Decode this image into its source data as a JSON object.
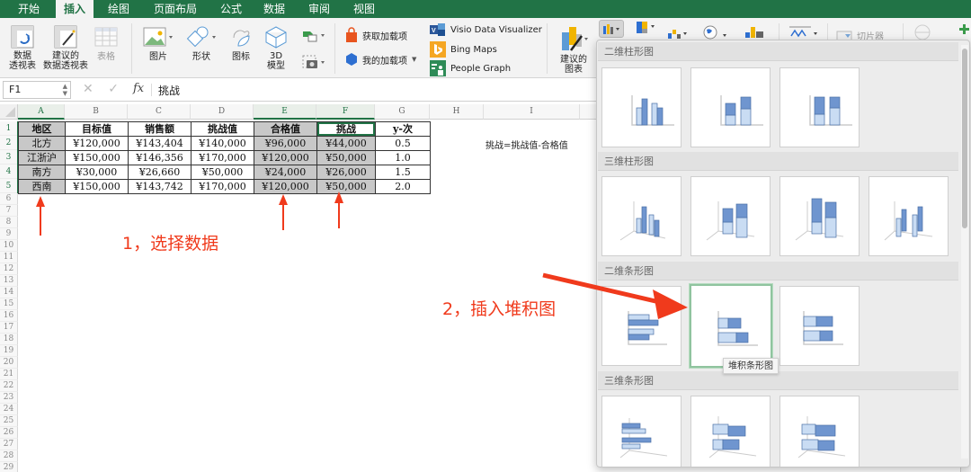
{
  "tabs": [
    {
      "label": "开始",
      "active": false
    },
    {
      "label": "插入",
      "active": true
    },
    {
      "label": "绘图",
      "active": false
    },
    {
      "label": "页面布局",
      "active": false
    },
    {
      "label": "公式",
      "active": false
    },
    {
      "label": "数据",
      "active": false
    },
    {
      "label": "审阅",
      "active": false
    },
    {
      "label": "视图",
      "active": false
    }
  ],
  "ribbon": {
    "pivot_table": "数据\n透视表",
    "pivot_table_l1": "数据",
    "pivot_table_l2": "透视表",
    "recommended_pivot_l1": "建议的",
    "recommended_pivot_l2": "数据透视表",
    "table": "表格",
    "pictures": "图片",
    "shapes": "形状",
    "icons": "图标",
    "model_3d_l1": "3D",
    "model_3d_l2": "模型",
    "get_addins": "获取加载项",
    "my_addins": "我的加载项",
    "visio": "Visio Data Visualizer",
    "bing_maps": "Bing Maps",
    "people_graph": "People Graph",
    "recommended_charts_l1": "建议的",
    "recommended_charts_l2": "图表",
    "slicer": "切片器",
    "colors": {
      "accent": "#217346",
      "office_orange": "#e8541e",
      "bing": "#f5a623",
      "visio": "#2b579a"
    }
  },
  "formula_bar": {
    "name_box": "F1",
    "fx": "fx",
    "value": "挑战"
  },
  "sheet": {
    "columns": [
      "A",
      "B",
      "C",
      "D",
      "E",
      "F",
      "G",
      "H",
      "I"
    ],
    "selected_columns": [
      "A",
      "E",
      "F"
    ],
    "rows": [
      "1",
      "2",
      "3",
      "4",
      "5",
      "6",
      "7",
      "8",
      "9",
      "10",
      "11",
      "12",
      "13",
      "14",
      "15",
      "16",
      "17",
      "18",
      "19",
      "20",
      "21",
      "22",
      "23",
      "24",
      "25",
      "26",
      "27",
      "28",
      "29"
    ],
    "table": {
      "headers": [
        "地区",
        "目标值",
        "销售额",
        "挑战值",
        "合格值",
        "挑战",
        "y-次"
      ],
      "rows": [
        [
          "北方",
          "¥120,000",
          "¥143,404",
          "¥140,000",
          "¥96,000",
          "¥44,000",
          "0.5"
        ],
        [
          "江浙沪",
          "¥150,000",
          "¥146,356",
          "¥170,000",
          "¥120,000",
          "¥50,000",
          "1.0"
        ],
        [
          "南方",
          "¥30,000",
          "¥26,660",
          "¥50,000",
          "¥24,000",
          "¥26,000",
          "1.5"
        ],
        [
          "西南",
          "¥150,000",
          "¥143,742",
          "¥170,000",
          "¥120,000",
          "¥50,000",
          "2.0"
        ]
      ]
    },
    "note": "挑战=挑战值-合格值"
  },
  "annotations": {
    "step1": "1，选择数据",
    "step2": "2，插入堆积图",
    "color": "#f03a1c"
  },
  "gallery": {
    "sections": [
      {
        "title": "二维柱形图",
        "items": [
          "簇状柱形图",
          "堆积柱形图",
          "百分比堆积柱形图"
        ]
      },
      {
        "title": "三维柱形图",
        "items": [
          "三维簇状柱形图",
          "三维堆积柱形图",
          "三维百分比堆积柱形图",
          "三维柱形图"
        ]
      },
      {
        "title": "二维条形图",
        "items": [
          "簇状条形图",
          "堆积条形图",
          "百分比堆积条形图"
        ]
      },
      {
        "title": "三维条形图",
        "items": [
          "三维簇状条形图",
          "三维堆积条形图",
          "三维百分比堆积条形图"
        ]
      }
    ],
    "hovered": "堆积条形图",
    "tooltip": "堆积条形图",
    "colors": {
      "dark": "#6f95cf",
      "light": "#c9dcf3",
      "stroke": "#4a6fa5",
      "highlight": "#90c49f"
    }
  }
}
